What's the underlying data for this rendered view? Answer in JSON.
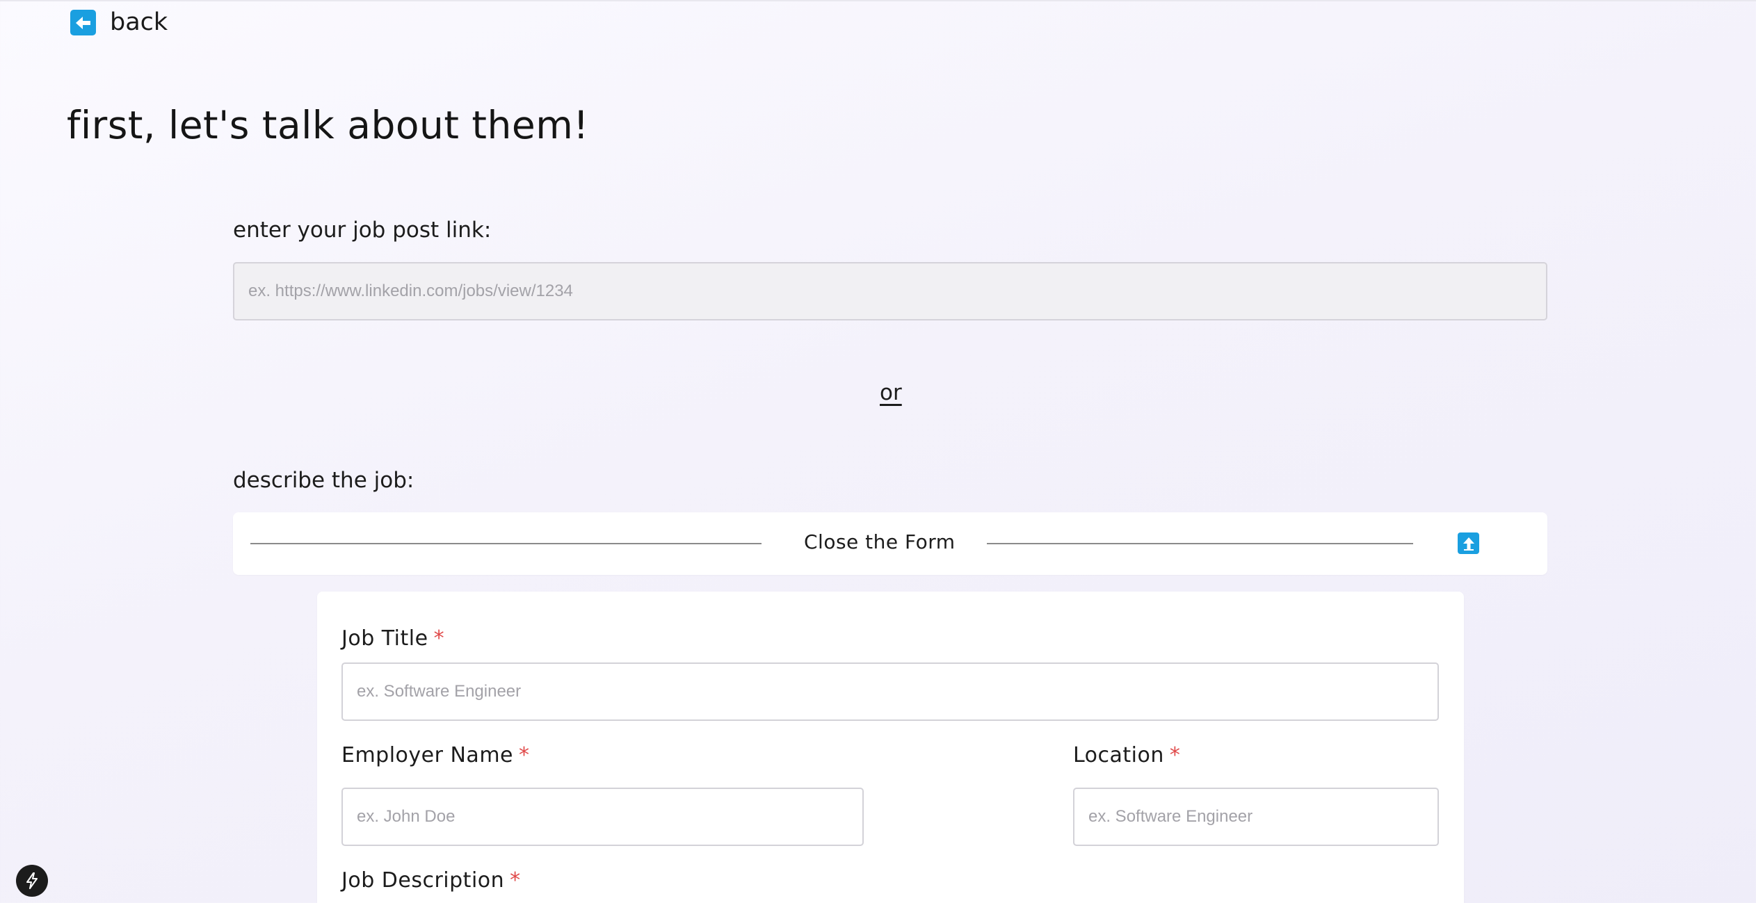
{
  "nav": {
    "back_label": "back"
  },
  "page": {
    "title": "first, let's talk about them!"
  },
  "job_link": {
    "label": "enter your job post link:",
    "placeholder": "ex. https://www.linkedin.com/jobs/view/1234",
    "value": ""
  },
  "divider": {
    "or_text": "or"
  },
  "describe": {
    "label": "describe the job:",
    "close_form_label": "Close the Form"
  },
  "form": {
    "required_marker": "*",
    "job_title": {
      "label": "Job Title",
      "placeholder": "ex. Software Engineer",
      "value": ""
    },
    "employer_name": {
      "label": "Employer Name",
      "placeholder": "ex. John Doe",
      "value": ""
    },
    "location": {
      "label": "Location",
      "placeholder": "ex. Software Engineer",
      "value": ""
    },
    "job_description": {
      "label": "Job Description"
    }
  },
  "icons": {
    "back": "arrow-left-icon",
    "collapse": "arrow-up-icon",
    "dev_badge": "lightning-bolt-icon"
  },
  "colors": {
    "accent": "#1a9fe0",
    "required": "#e04a4a",
    "dev_badge": "#1c1c1c"
  }
}
